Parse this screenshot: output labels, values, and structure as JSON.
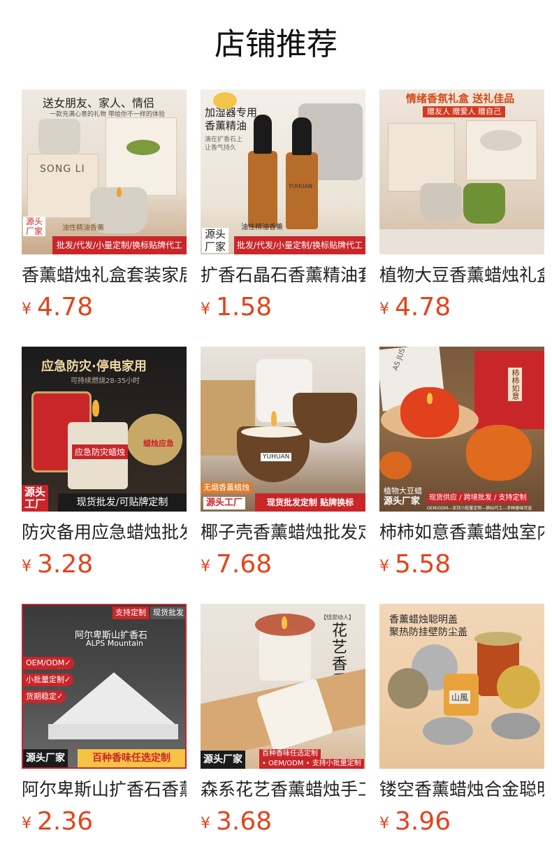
{
  "page": {
    "title": "店铺推荐"
  },
  "currency": "¥",
  "products": [
    {
      "name": "香薰蜡烛礼盒套装家居",
      "price": "4.78",
      "img": {
        "top": "送女朋友、家人、情侣",
        "sub": "一款充满心意的礼物 带给你不一样的体验",
        "brand": "SONG LI",
        "badge": "源头\n厂家",
        "label": "油性精油香薰",
        "strip": "批发/代发/小量定制/换标贴牌代工"
      }
    },
    {
      "name": "扩香石晶石香薰精油套",
      "price": "1.58",
      "img": {
        "top": "加湿器专用\n香薰精油",
        "sub": "滴在扩香石上\n让香气持久",
        "brand": "YUHUAN",
        "badge": "源头\n厂家",
        "label": "油性精油香薰",
        "strip": "批发/代发/小量定制/换标贴牌代工"
      }
    },
    {
      "name": "植物大豆香薰蜡烛礼盒",
      "price": "4.78",
      "img": {
        "top": "情绪香氛礼盒 送礼佳品",
        "sub": "赠友人 赠爱人 赠自己"
      }
    },
    {
      "name": "防灾备用应急蜡烛批发",
      "price": "3.28",
      "img": {
        "top": "应急防灾·停电家用",
        "sub": "可持续燃烧28-35小时",
        "label": "应急防灾蜡烛",
        "tin": "蜡烛应急",
        "badge": "源头\n工厂",
        "strip": "现货批发/可贴牌定制"
      }
    },
    {
      "name": "椰子壳香薰蜡烛批发定",
      "price": "7.68",
      "img": {
        "brand": "YUHUAN",
        "label": "无烟香薰蜡烛",
        "badge": "源头工厂",
        "strip": "现货批发定制 贴牌换标"
      }
    },
    {
      "name": "柿柿如意香薰蜡烛室内",
      "price": "5.58",
      "img": {
        "box": "柿柿如意",
        "side": "AS JUST",
        "label": "植物大豆蜡",
        "badge": "源头厂家",
        "strip": "现货供应 / 跨境批发 / 支持定制",
        "sub": "OEM/ODM—支持小批量定制—换标代工—多种香味可选"
      }
    },
    {
      "name": "阿尔卑斯山扩香石香薰",
      "price": "2.36",
      "img": {
        "tag1": "支持定制",
        "tag2": "现货批发",
        "top": "阿尔卑斯山扩香石",
        "sub": "ALPS Mountain",
        "chips": [
          "OEM/ODM✓",
          "小批量定制✓",
          "货期稳定✓"
        ],
        "badge": "源头厂家",
        "strip": "百种香味任选定制"
      }
    },
    {
      "name": "森系花艺香薰蜡烛手工",
      "price": "3.68",
      "img": {
        "vert": "花艺香熏",
        "small": "【恬觉动人】",
        "badge": "源头厂家",
        "label": "百种香味任选定制",
        "strip": "• OEM/ODM • 支持小批量定制"
      }
    },
    {
      "name": "镂空香薰蜡烛合金聪明",
      "price": "3.96",
      "img": {
        "top": "香薰蜡烛聪明盖\n聚热防挂壁防尘盖",
        "jar": "山風"
      }
    }
  ]
}
